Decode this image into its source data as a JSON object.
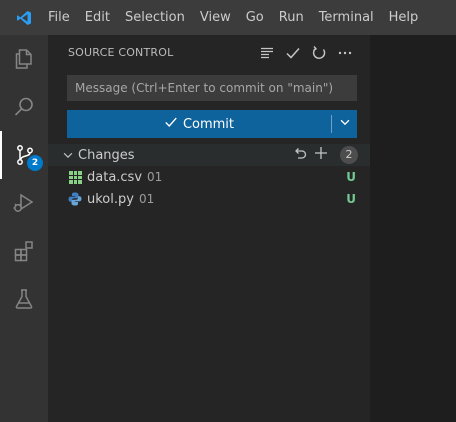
{
  "menu": {
    "items": [
      "File",
      "Edit",
      "Selection",
      "View",
      "Go",
      "Run",
      "Terminal",
      "Help"
    ]
  },
  "activity_bar": {
    "items": [
      {
        "name": "explorer",
        "icon": "files-icon"
      },
      {
        "name": "search",
        "icon": "search-icon"
      },
      {
        "name": "source-control",
        "icon": "source-control-icon",
        "badge": "2",
        "active": true
      },
      {
        "name": "run-debug",
        "icon": "run-debug-icon"
      },
      {
        "name": "extensions",
        "icon": "extensions-icon"
      },
      {
        "name": "testing",
        "icon": "flask-icon"
      }
    ]
  },
  "sidebar": {
    "title": "SOURCE CONTROL",
    "actions": [
      "list-icon",
      "check-icon",
      "refresh-icon",
      "more-icon"
    ],
    "message_placeholder": "Message (Ctrl+Enter to commit on \"main\")",
    "commit_label": "Commit",
    "changes": {
      "label": "Changes",
      "count": "2",
      "files": [
        {
          "name": "data.csv",
          "description": "01",
          "status": "U",
          "icon": "table-file-icon"
        },
        {
          "name": "ukol.py",
          "description": "01",
          "status": "U",
          "icon": "python-file-icon"
        }
      ]
    }
  },
  "colors": {
    "accent": "#007acc",
    "commit_button": "#0e639c",
    "untracked": "#73c991"
  }
}
